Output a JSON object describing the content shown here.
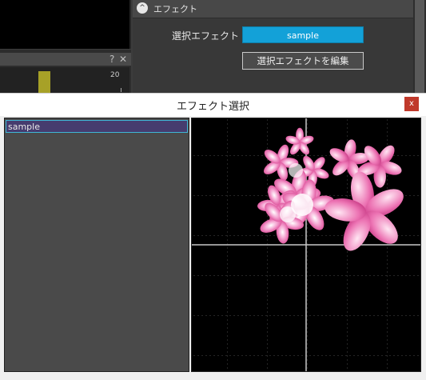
{
  "background_app": {
    "timeline": {
      "help_label": "?",
      "close_label": "✕",
      "frame_number": "20"
    },
    "inspector": {
      "collapse_glyph": "^",
      "section_title": "エフェクト",
      "effect_field_label": "選択エフェクト",
      "effect_value": "sample",
      "edit_button_label": "選択エフェクトを編集"
    }
  },
  "dialog": {
    "title": "エフェクト選択",
    "close_label": "x",
    "effects_list": [
      "sample"
    ],
    "selected_effect": "sample"
  },
  "colors": {
    "accent_blue": "#13a1d8",
    "selection_bg": "#463c6e",
    "selection_border": "#3fb6d6",
    "close_red": "#c0392b",
    "timeline_marker": "#a7a127",
    "petal_pink": "#e0509a"
  }
}
